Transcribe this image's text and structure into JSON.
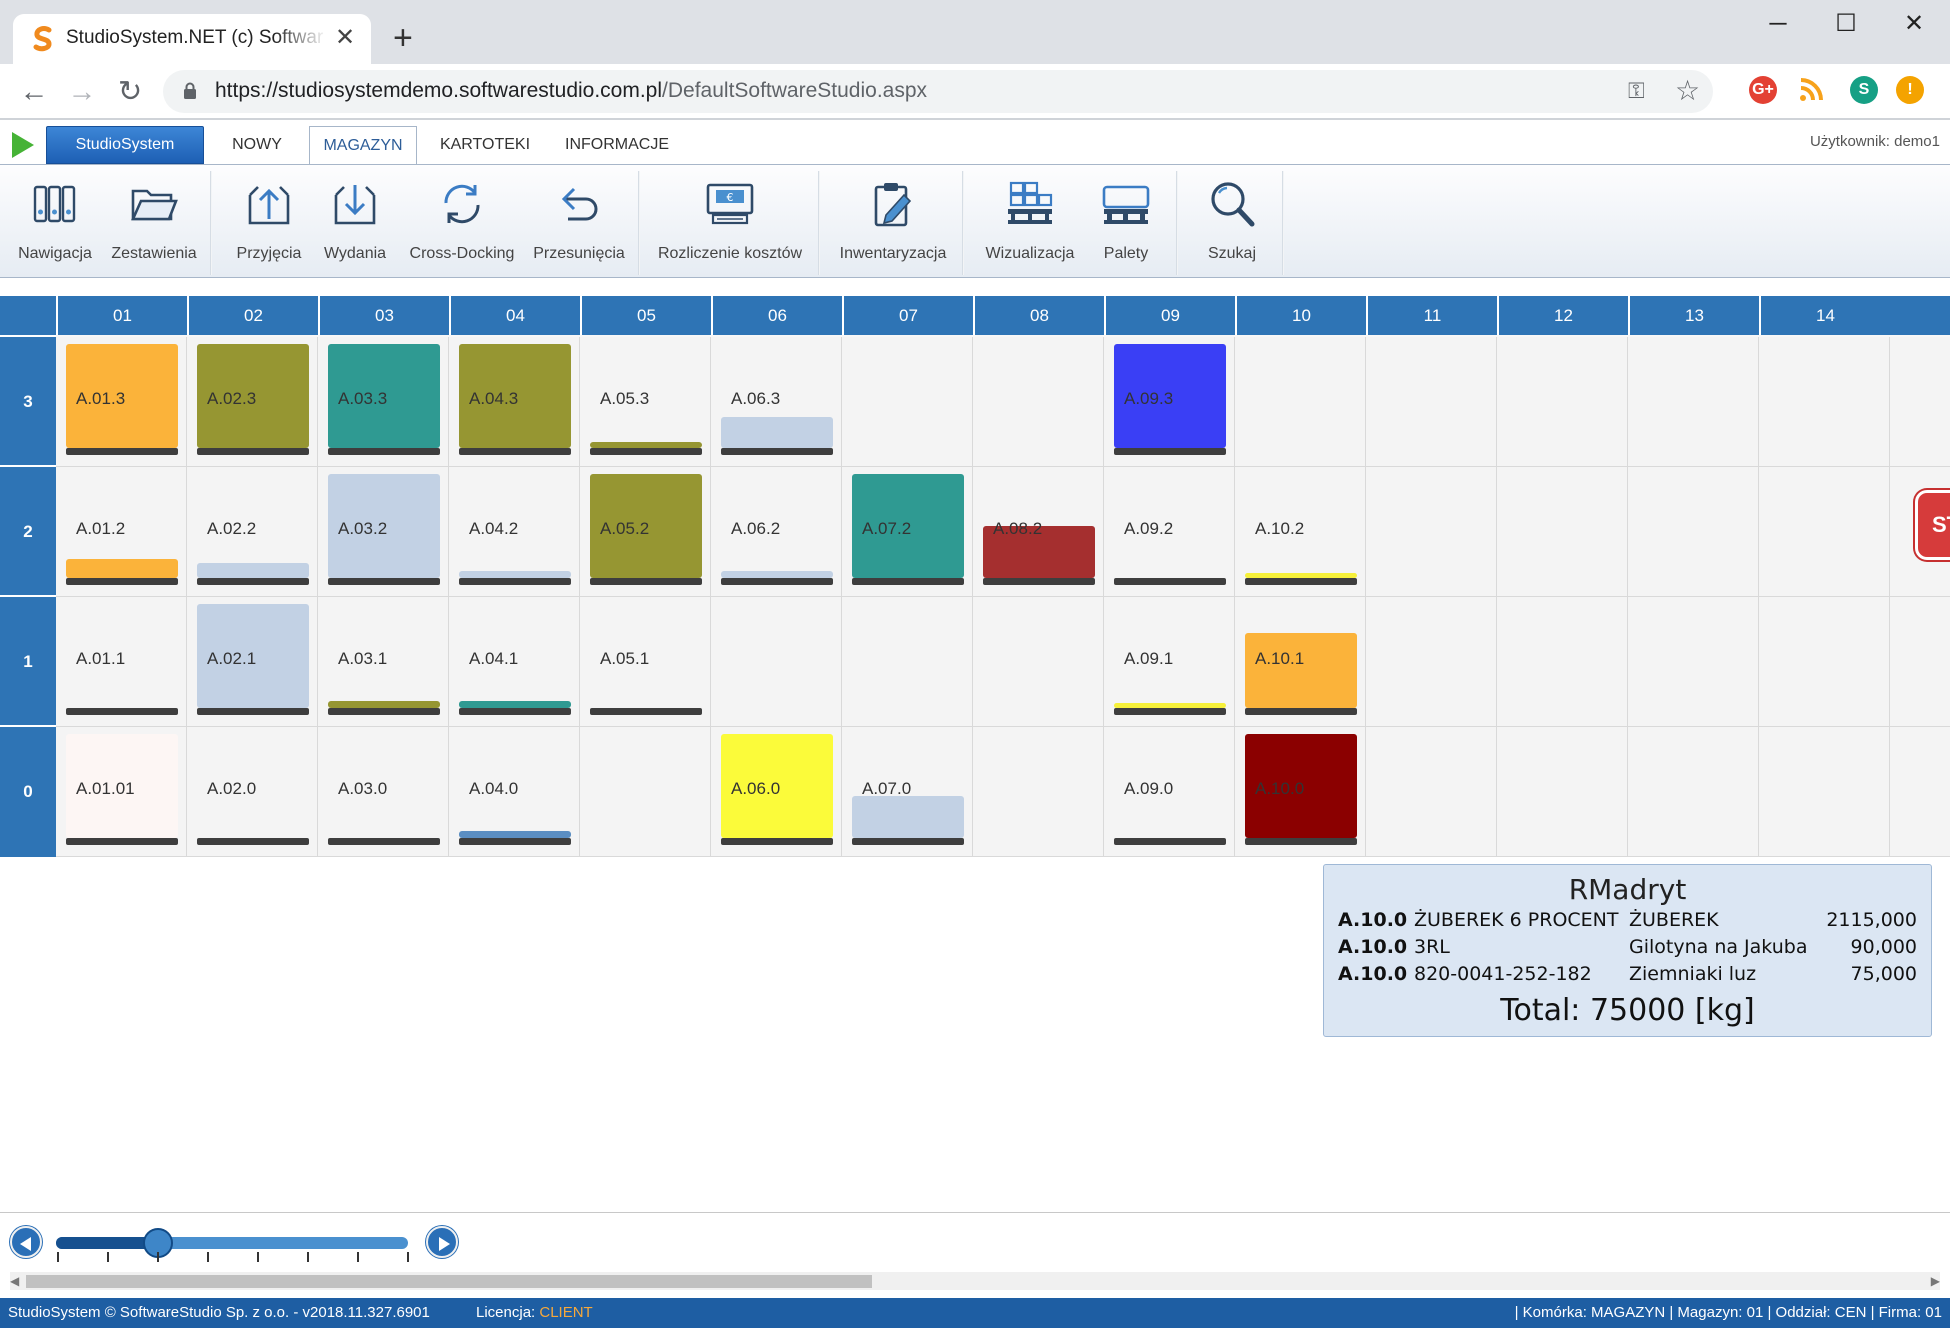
{
  "browser": {
    "tab_title": "StudioSystem.NET (c) SoftwareStudio",
    "url_host": "https://studiosystemdemo.softwarestudio.com.pl",
    "url_path": "/DefaultSoftwareStudio.aspx",
    "extensions": [
      {
        "name": "google-plus-icon",
        "label": "G+",
        "color": "#e34133"
      },
      {
        "name": "rss-icon",
        "label": "",
        "color": "#f7a21b"
      },
      {
        "name": "profile-avatar",
        "label": "S",
        "color": "#16a085"
      },
      {
        "name": "update-alert-icon",
        "label": "!",
        "color": "#f4a300"
      }
    ]
  },
  "app": {
    "button_label": "StudioSystem",
    "menu_tabs": [
      {
        "label": "NOWY",
        "active": false
      },
      {
        "label": "MAGAZYN",
        "active": true
      },
      {
        "label": "KARTOTEKI",
        "active": false
      },
      {
        "label": "INFORMACJE",
        "active": false
      }
    ],
    "user": "Użytkownik: demo1"
  },
  "ribbon": [
    {
      "label": "Nawigacja",
      "icon": "binders-icon"
    },
    {
      "label": "Zestawienia",
      "icon": "folder-open-icon"
    },
    {
      "label": "Przyjęcia",
      "icon": "box-upload-icon"
    },
    {
      "label": "Wydania",
      "icon": "box-download-icon"
    },
    {
      "label": "Cross-Docking",
      "icon": "refresh-cycle-icon"
    },
    {
      "label": "Przesunięcia",
      "icon": "undo-arrow-icon"
    },
    {
      "label": "Rozliczenie kosztów",
      "icon": "cash-register-icon"
    },
    {
      "label": "Inwentaryzacja",
      "icon": "clipboard-pencil-icon"
    },
    {
      "label": "Wizualizacja",
      "icon": "pallet-boxes-icon"
    },
    {
      "label": "Palety",
      "icon": "pallet-icon"
    },
    {
      "label": "Szukaj",
      "icon": "magnifier-icon"
    }
  ],
  "warehouse": {
    "columns": [
      "01",
      "02",
      "03",
      "04",
      "05",
      "06",
      "07",
      "08",
      "09",
      "10",
      "11",
      "12",
      "13",
      "14"
    ],
    "rows": [
      "3",
      "2",
      "1",
      "0"
    ],
    "cells": [
      {
        "row": 0,
        "col": 0,
        "label": "A.01.3",
        "fill": 1.0,
        "color": "#fbb33a"
      },
      {
        "row": 0,
        "col": 1,
        "label": "A.02.3",
        "fill": 1.0,
        "color": "#969632"
      },
      {
        "row": 0,
        "col": 2,
        "label": "A.03.3",
        "fill": 1.0,
        "color": "#2f9a92"
      },
      {
        "row": 0,
        "col": 3,
        "label": "A.04.3",
        "fill": 1.0,
        "color": "#969632"
      },
      {
        "row": 0,
        "col": 4,
        "label": "A.05.3",
        "fill": 0.06,
        "color": "#969632"
      },
      {
        "row": 0,
        "col": 5,
        "label": "A.06.3",
        "fill": 0.3,
        "color": "#c2d1e4"
      },
      {
        "row": 0,
        "col": 8,
        "label": "A.09.3",
        "fill": 1.0,
        "color": "#3a3ff5"
      },
      {
        "row": 1,
        "col": 0,
        "label": "A.01.2",
        "fill": 0.18,
        "color": "#fbb33a"
      },
      {
        "row": 1,
        "col": 1,
        "label": "A.02.2",
        "fill": 0.14,
        "color": "#c2d1e4"
      },
      {
        "row": 1,
        "col": 2,
        "label": "A.03.2",
        "fill": 1.0,
        "color": "#c2d1e4"
      },
      {
        "row": 1,
        "col": 3,
        "label": "A.04.2",
        "fill": 0.07,
        "color": "#c2d1e4"
      },
      {
        "row": 1,
        "col": 4,
        "label": "A.05.2",
        "fill": 1.0,
        "color": "#969632"
      },
      {
        "row": 1,
        "col": 5,
        "label": "A.06.2",
        "fill": 0.07,
        "color": "#c2d1e4"
      },
      {
        "row": 1,
        "col": 6,
        "label": "A.07.2",
        "fill": 1.0,
        "color": "#2f9a92"
      },
      {
        "row": 1,
        "col": 7,
        "label": "A.08.2",
        "fill": 0.5,
        "color": "#a52f2f"
      },
      {
        "row": 1,
        "col": 8,
        "label": "A.09.2",
        "fill": 0.0,
        "color": "#c2d1e4"
      },
      {
        "row": 1,
        "col": 9,
        "label": "A.10.2",
        "fill": 0.05,
        "color": "#f6f03a"
      },
      {
        "row": 2,
        "col": 0,
        "label": "A.01.1",
        "fill": 0.0,
        "color": "#c2d1e4"
      },
      {
        "row": 2,
        "col": 1,
        "label": "A.02.1",
        "fill": 1.0,
        "color": "#c2d1e4"
      },
      {
        "row": 2,
        "col": 2,
        "label": "A.03.1",
        "fill": 0.07,
        "color": "#969632"
      },
      {
        "row": 2,
        "col": 3,
        "label": "A.04.1",
        "fill": 0.07,
        "color": "#2f9a92"
      },
      {
        "row": 2,
        "col": 4,
        "label": "A.05.1",
        "fill": 0.0,
        "color": "#c2d1e4"
      },
      {
        "row": 2,
        "col": 8,
        "label": "A.09.1",
        "fill": 0.05,
        "color": "#f6f03a"
      },
      {
        "row": 2,
        "col": 9,
        "label": "A.10.1",
        "fill": 0.72,
        "color": "#fbb33a"
      },
      {
        "row": 3,
        "col": 0,
        "label": "A.01.01",
        "fill": 1.0,
        "color": "#fdf6f4"
      },
      {
        "row": 3,
        "col": 1,
        "label": "A.02.0",
        "fill": 0.0,
        "color": "#c2d1e4"
      },
      {
        "row": 3,
        "col": 2,
        "label": "A.03.0",
        "fill": 0.0,
        "color": "#c2d1e4"
      },
      {
        "row": 3,
        "col": 3,
        "label": "A.04.0",
        "fill": 0.07,
        "color": "#5b8ec2"
      },
      {
        "row": 3,
        "col": 5,
        "label": "A.06.0",
        "fill": 1.0,
        "color": "#fbfb3a"
      },
      {
        "row": 3,
        "col": 6,
        "label": "A.07.0",
        "fill": 0.4,
        "color": "#c2d1e4"
      },
      {
        "row": 3,
        "col": 8,
        "label": "A.09.0",
        "fill": 0.0,
        "color": "#c2d1e4"
      },
      {
        "row": 3,
        "col": 9,
        "label": "A.10.0",
        "fill": 1.0,
        "color": "#8b0000"
      }
    ]
  },
  "popup": {
    "title": "RMadryt",
    "rows": [
      {
        "cell": "A.10.0",
        "product": "ŻUBEREK 6 PROCENT",
        "name": "ŻUBEREK",
        "qty": "2115,000"
      },
      {
        "cell": "A.10.0",
        "product": "3RL",
        "name": "Gilotyna na Jakuba",
        "qty": "90,000"
      },
      {
        "cell": "A.10.0",
        "product": "820-0041-252-182",
        "name": "Ziemniaki luz",
        "qty": "75,000"
      }
    ],
    "total": "Total: 75000 [kg]"
  },
  "stop_sign": "ST",
  "slider": {
    "value": 0.29,
    "ticks": 8
  },
  "status": {
    "left": "StudioSystem © SoftwareStudio Sp. z o.o. - v2018.11.327.6901",
    "license_label": "Licencja: ",
    "license_value": "CLIENT",
    "right": "| Komórka: MAGAZYN | Magazyn: 01 | Oddział: CEN | Firma: 01"
  }
}
